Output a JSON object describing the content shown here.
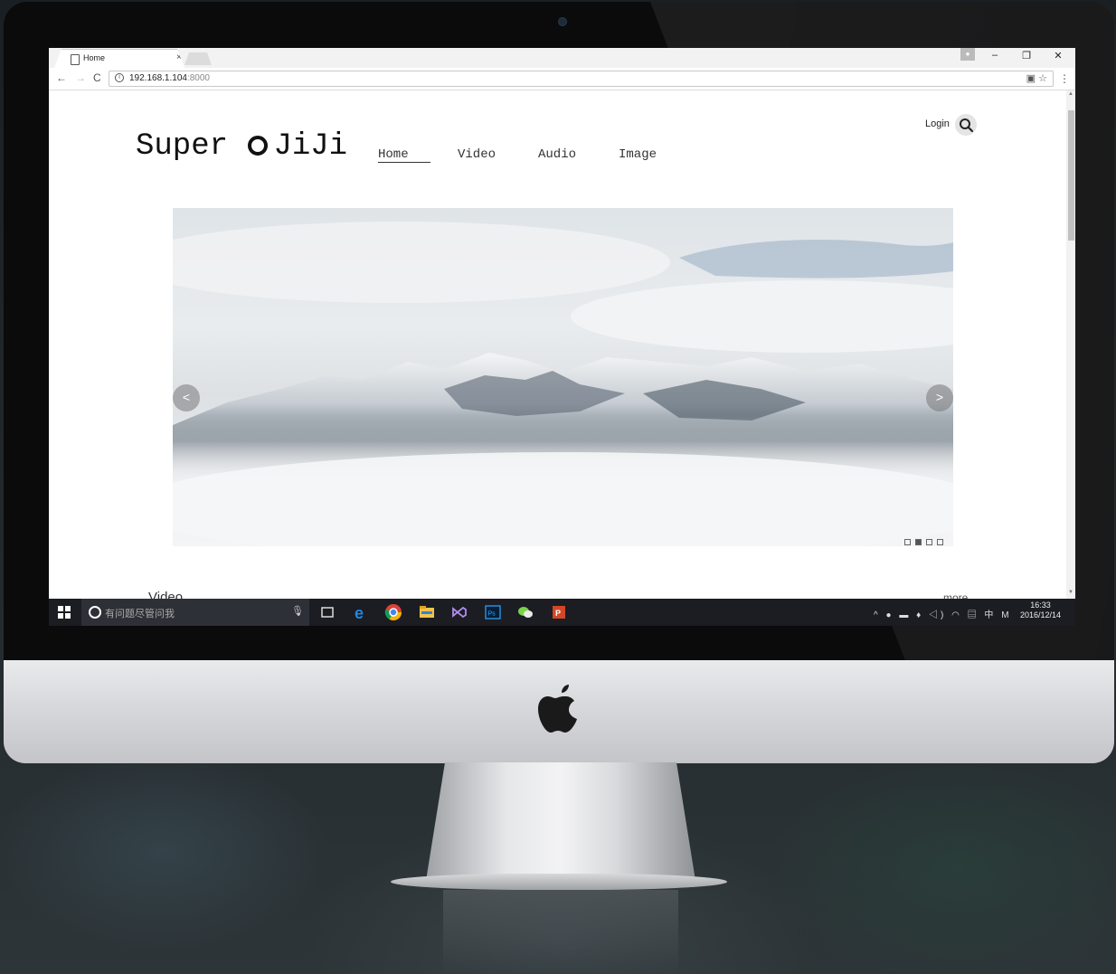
{
  "browser": {
    "tab_title": "Home",
    "tab_close": "×",
    "url_host": "192.168.1.104",
    "url_port": ":8000",
    "window_minimize": "–",
    "window_restore": "❐",
    "window_close": "✕"
  },
  "site": {
    "brand_left": "Super",
    "brand_right": "JiJi",
    "nav": [
      {
        "label": "Home"
      },
      {
        "label": "Video"
      },
      {
        "label": "Audio"
      },
      {
        "label": "Image"
      }
    ],
    "login_label": "Login",
    "carousel": {
      "prev": "<",
      "next": ">",
      "slide_count": 4,
      "active_slide": 2
    },
    "section_title": "Video",
    "section_more": "more"
  },
  "taskbar": {
    "search_placeholder": "有问题尽管问我",
    "time": "16:33",
    "date": "2016/12/14",
    "ime_label": "中",
    "ime_mode": "M",
    "apps": [
      "task-view-icon",
      "edge-icon",
      "chrome-icon",
      "file-explorer-icon",
      "visual-studio-icon",
      "photoshop-icon",
      "wechat-icon",
      "powerpoint-icon"
    ]
  },
  "colors": {
    "taskbar_bg": "#1b1d22",
    "running_indicator": "#e9a4a0"
  }
}
